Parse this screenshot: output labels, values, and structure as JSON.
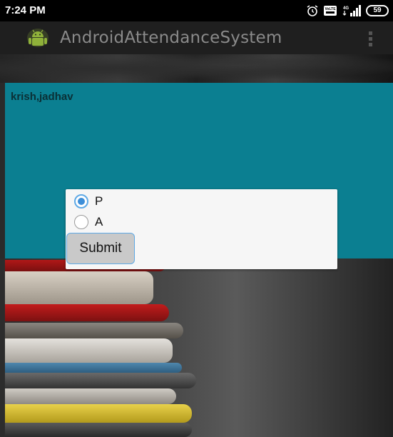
{
  "status_bar": {
    "time": "7:24 PM",
    "icons": [
      "alarm-icon",
      "volte-icon",
      "4g-signal-icon",
      "battery-icon"
    ],
    "network_label": "4G",
    "volte_label": "VoLTE",
    "battery_level": "59"
  },
  "action_bar": {
    "app_icon": "android-icon",
    "title": "AndroidAttendanceSystem",
    "menu_icon": "overflow-menu-icon"
  },
  "main": {
    "student_name": "krish,jadhav"
  },
  "dialog": {
    "options": [
      {
        "label": "P",
        "checked": true
      },
      {
        "label": "A",
        "checked": false
      }
    ],
    "submit_label": "Submit"
  },
  "colors": {
    "panel_teal": "#0b7f91",
    "radio_accent": "#3d8ed8",
    "status_bar": "#000000",
    "action_bar": "#1f1f1f",
    "dialog_bg": "#f6f6f6",
    "button_bg": "#c9c9c9"
  }
}
